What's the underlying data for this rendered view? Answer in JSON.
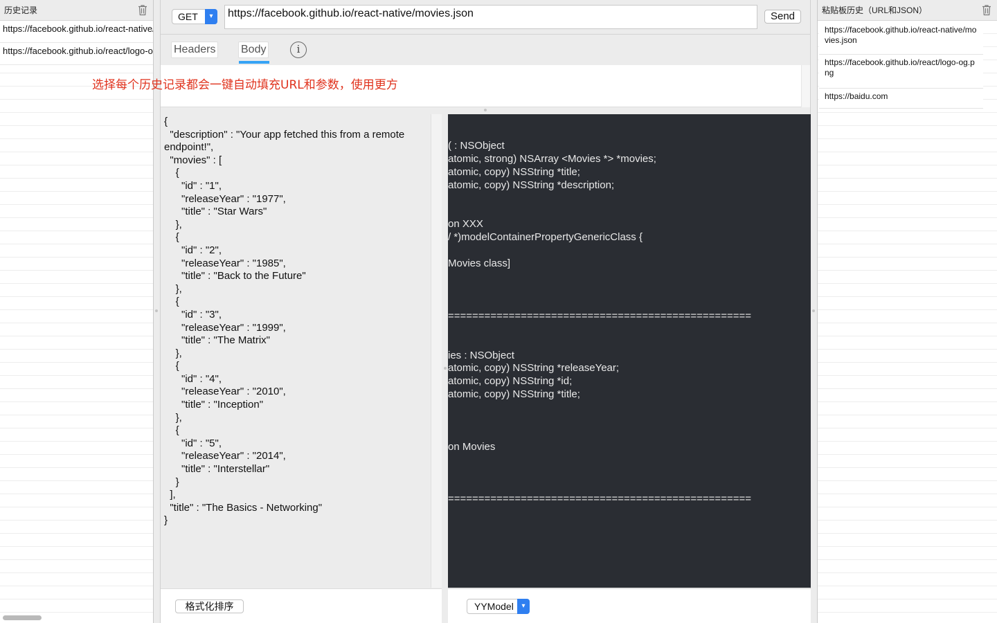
{
  "history": {
    "title": "历史记录",
    "items": [
      "https://facebook.github.io/react-native/movies.json",
      "https://facebook.github.io/react/logo-og.png"
    ]
  },
  "request": {
    "method": "GET",
    "url": "https://facebook.github.io/react-native/movies.json",
    "send_label": "Send"
  },
  "tabs": {
    "headers": "Headers",
    "body": "Body",
    "info_glyph": "i"
  },
  "notice": "选择每个历史记录都会一键自动填充URL和参数，使用更方",
  "json_body": "{\n  \"description\" : \"Your app fetched this from a remote\nendpoint!\",\n  \"movies\" : [\n    {\n      \"id\" : \"1\",\n      \"releaseYear\" : \"1977\",\n      \"title\" : \"Star Wars\"\n    },\n    {\n      \"id\" : \"2\",\n      \"releaseYear\" : \"1985\",\n      \"title\" : \"Back to the Future\"\n    },\n    {\n      \"id\" : \"3\",\n      \"releaseYear\" : \"1999\",\n      \"title\" : \"The Matrix\"\n    },\n    {\n      \"id\" : \"4\",\n      \"releaseYear\" : \"2010\",\n      \"title\" : \"Inception\"\n    },\n    {\n      \"id\" : \"5\",\n      \"releaseYear\" : \"2014\",\n      \"title\" : \"Interstellar\"\n    }\n  ],\n  \"title\" : \"The Basics - Networking\"\n}",
  "model_code": "( : NSObject\natomic, strong) NSArray <Movies *> *movies;\natomic, copy) NSString *title;\natomic, copy) NSString *description;\n\n\non XXX\n/ *)modelContainerPropertyGenericClass {\n\nMovies class]\n\n\n\n==================================================\n\n\nies : NSObject\natomic, copy) NSString *releaseYear;\natomic, copy) NSString *id;\natomic, copy) NSString *title;\n\n\n\non Movies\n\n\n\n==================================================",
  "bottom": {
    "format_label": "格式化排序",
    "model_label": "YYModel"
  },
  "clipboard": {
    "title": "粘贴板历史（URL和JSON）",
    "items": [
      "https://facebook.github.io/react-native/movies.json",
      "https://facebook.github.io/react/logo-og.png",
      "https://baidu.com"
    ]
  },
  "colors": {
    "accent": "#2f7ff0",
    "tab_underline": "#37a3f5",
    "notice_red": "#e0331e",
    "code_bg": "#2a2d33"
  }
}
